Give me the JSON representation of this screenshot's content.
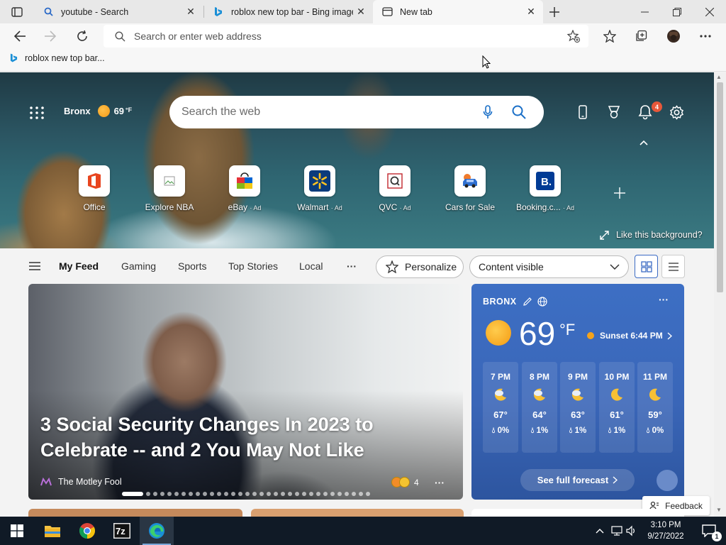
{
  "browser": {
    "tabs": [
      {
        "title": "youtube - Search",
        "favicon": "search-icon",
        "active": false
      },
      {
        "title": "roblox new top bar - Bing image",
        "favicon": "bing-icon",
        "active": false
      },
      {
        "title": "New tab",
        "favicon": "newtab-page-icon",
        "active": true
      }
    ],
    "address_placeholder": "Search or enter web address",
    "favorites": [
      {
        "label": "roblox new top bar...",
        "icon": "bing-icon"
      }
    ]
  },
  "newtab": {
    "location": "Bronx",
    "temp": "69",
    "temp_unit": "°F",
    "search_placeholder": "Search the web",
    "notification_count": "4",
    "quick_links": [
      {
        "label": "Office",
        "ad": ""
      },
      {
        "label": "Explore NBA",
        "ad": ""
      },
      {
        "label": "eBay",
        "ad": "· Ad"
      },
      {
        "label": "Walmart",
        "ad": "· Ad"
      },
      {
        "label": "QVC",
        "ad": "· Ad"
      },
      {
        "label": "Cars for Sale",
        "ad": ""
      },
      {
        "label": "Booking.c...",
        "ad": "· Ad"
      }
    ],
    "like_background": "Like this background?"
  },
  "feed_nav": {
    "items": [
      "My Feed",
      "Gaming",
      "Sports",
      "Top Stories",
      "Local"
    ],
    "more": "···",
    "personalize": "Personalize",
    "content_visible": "Content visible"
  },
  "article": {
    "title": "3 Social Security Changes In 2023 to Celebrate -- and 2 You May Not Like",
    "source": "The Motley Fool",
    "reaction_count": "4",
    "more": "···"
  },
  "weather": {
    "city": "BRONX",
    "temp": "69",
    "unit": "°F",
    "sunset": "Sunset 6:44 PM",
    "hours": [
      {
        "time": "7 PM",
        "temp": "67°",
        "precip": "0%",
        "icon": "partly-cloudy-night-icon"
      },
      {
        "time": "8 PM",
        "temp": "64°",
        "precip": "1%",
        "icon": "partly-cloudy-night-icon"
      },
      {
        "time": "9 PM",
        "temp": "63°",
        "precip": "1%",
        "icon": "partly-cloudy-night-icon"
      },
      {
        "time": "10 PM",
        "temp": "61°",
        "precip": "1%",
        "icon": "moon-icon"
      },
      {
        "time": "11 PM",
        "temp": "59°",
        "precip": "0%",
        "icon": "moon-icon"
      }
    ],
    "forecast_button": "See full forecast",
    "more": "···"
  },
  "feedback": "Feedback",
  "taskbar": {
    "time": "3:10 PM",
    "date": "9/27/2022",
    "apps": [
      "file-explorer-icon",
      "chrome-icon",
      "7zip-icon",
      "edge-icon"
    ],
    "notification_count": "1"
  },
  "colors": {
    "accent": "#3b6bc4",
    "badge": "#e8583a",
    "taskbar": "#101a26"
  }
}
